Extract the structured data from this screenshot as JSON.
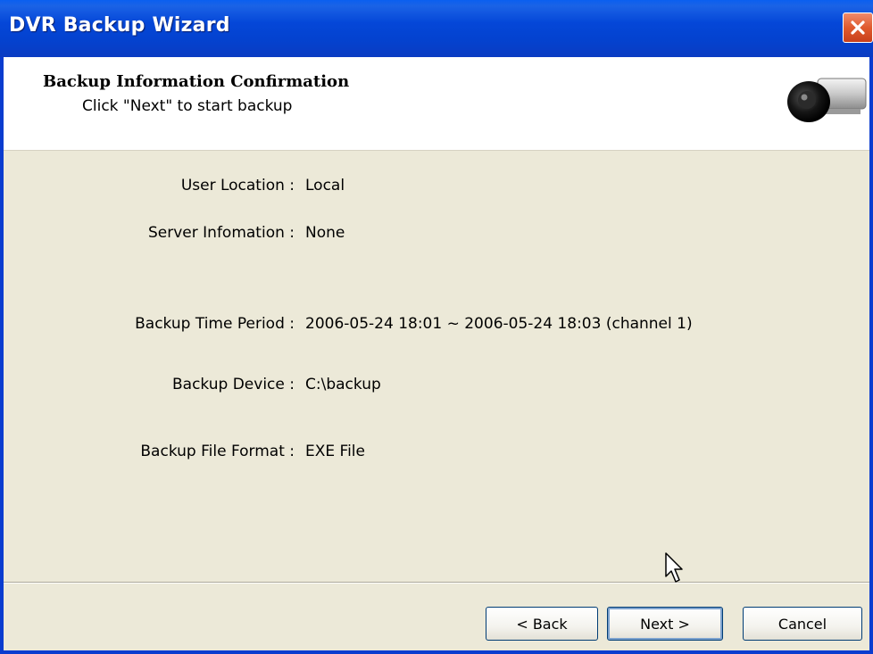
{
  "window": {
    "title": "DVR Backup Wizard"
  },
  "header": {
    "title": "Backup Information Confirmation",
    "subtitle": "Click \"Next\" to start backup",
    "icon": "camera-icon"
  },
  "fields": [
    {
      "label": "User Location :",
      "value": "Local"
    },
    {
      "label": "Server Infomation :",
      "value": "None"
    },
    {
      "label": "Backup Time Period :",
      "value": "2006-05-24 18:01 ~ 2006-05-24 18:03 (channel 1)"
    },
    {
      "label": "Backup Device :",
      "value": "C:\\backup"
    },
    {
      "label": "Backup File Format :",
      "value": "EXE File"
    }
  ],
  "buttons": {
    "back": "< Back",
    "next": "Next >",
    "cancel": "Cancel"
  },
  "colors": {
    "titlebar": "#0547d8",
    "close": "#e05a2e",
    "body": "#ece9d8"
  }
}
